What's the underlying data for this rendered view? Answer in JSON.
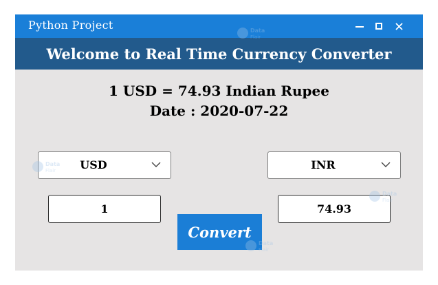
{
  "window": {
    "title": "Python Project",
    "controls": [
      "minimize-icon",
      "maximize-icon",
      "close-icon"
    ],
    "accent_color": "#1a7fd8"
  },
  "banner": {
    "text": "Welcome to Real Time Currency Converter",
    "color": "#225a8c"
  },
  "rate": {
    "text": "1 USD = 74.93 Indian Rupee",
    "date_text": "Date : 2020-07-22"
  },
  "from_currency": {
    "selected": "USD",
    "icon": "chevron-down-icon"
  },
  "to_currency": {
    "selected": "INR",
    "icon": "chevron-down-icon"
  },
  "amount": {
    "value": "1"
  },
  "result": {
    "value": "74.93"
  },
  "convert_button": {
    "label": "Convert",
    "color": "#1b7ed6"
  },
  "watermark": {
    "text_line1": "Data",
    "text_line2": "Flair"
  }
}
